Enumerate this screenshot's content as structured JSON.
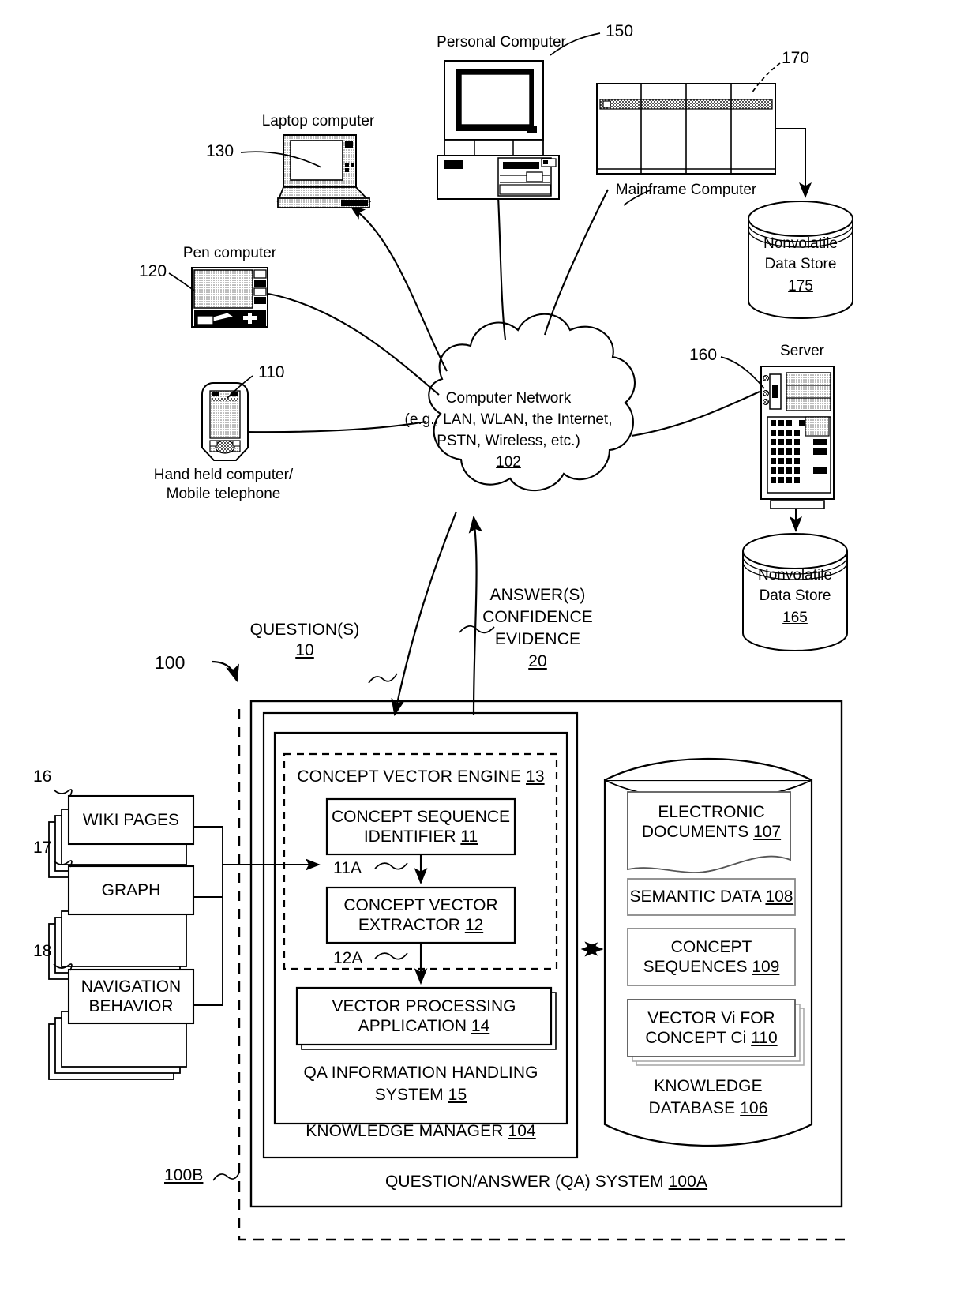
{
  "figure": {
    "main_ref": "100",
    "network": {
      "name": "Computer Network",
      "detail": "(e.g., LAN, WLAN, the Internet,",
      "detail2": "PSTN, Wireless, etc.)",
      "ref": "102"
    },
    "devices": [
      {
        "id": "handheld",
        "label_line1": "Hand held computer/",
        "label_line2": "Mobile telephone",
        "ref": "110",
        "icon": "pda-phone-icon"
      },
      {
        "id": "pen",
        "label": "Pen computer",
        "ref": "120",
        "icon": "tablet-pen-icon"
      },
      {
        "id": "laptop",
        "label": "Laptop computer",
        "ref": "130",
        "icon": "laptop-icon"
      },
      {
        "id": "pc",
        "label": "Personal Computer",
        "ref": "150",
        "icon": "desktop-computer-icon"
      },
      {
        "id": "mainframe",
        "label": "Mainframe Computer",
        "ref": "170",
        "icon": "mainframe-icon"
      },
      {
        "id": "server",
        "label": "Server",
        "ref": "160",
        "icon": "server-tower-icon"
      }
    ],
    "data_stores": [
      {
        "id": "store175",
        "line1": "Nonvolatile",
        "line2": "Data Store",
        "ref": "175"
      },
      {
        "id": "store165",
        "line1": "Nonvolatile",
        "line2": "Data Store",
        "ref": "165"
      }
    ],
    "flows": [
      {
        "id": "questions",
        "line1": "QUESTION(S)",
        "ref": "10"
      },
      {
        "id": "answers",
        "line1": "ANSWER(S)",
        "line2": "CONFIDENCE",
        "line3": "EVIDENCE",
        "ref": "20"
      }
    ],
    "sources": [
      {
        "label": "WIKI PAGES",
        "ref": "16"
      },
      {
        "label": "GRAPH",
        "ref": "17"
      },
      {
        "label_line1": "NAVIGATION",
        "label_line2": "BEHAVIOR",
        "ref": "18"
      }
    ],
    "qa_system": {
      "label": "QUESTION/ANSWER (QA) SYSTEM",
      "ref": "100A",
      "outer_ref": "100B",
      "knowledge_manager": {
        "label": "KNOWLEDGE MANAGER",
        "ref": "104"
      },
      "qa_ihs": {
        "line1": "QA INFORMATION HANDLING",
        "line2": "SYSTEM",
        "ref": "15"
      },
      "concept_vector_engine": {
        "label": "CONCEPT VECTOR ENGINE",
        "ref": "13"
      },
      "modules": [
        {
          "line1": "CONCEPT SEQUENCE",
          "line2": "IDENTIFIER",
          "ref": "11"
        },
        {
          "line1": "CONCEPT VECTOR",
          "line2": "EXTRACTOR",
          "ref": "12"
        },
        {
          "line1": "VECTOR PROCESSING",
          "line2": "APPLICATION",
          "ref": "14"
        }
      ],
      "internal_links": [
        {
          "ref": "11A"
        },
        {
          "ref": "12A"
        }
      ],
      "knowledge_database": {
        "line1": "KNOWLEDGE",
        "line2": "DATABASE",
        "ref": "106",
        "items": [
          {
            "line1": "ELECTRONIC",
            "line2": "DOCUMENTS",
            "ref": "107"
          },
          {
            "line1": "SEMANTIC DATA",
            "line2": "",
            "ref": "108"
          },
          {
            "line1": "CONCEPT",
            "line2": "SEQUENCES",
            "ref": "109"
          },
          {
            "line1": "VECTOR Vi FOR",
            "line2": "CONCEPT Ci",
            "ref": "110"
          }
        ]
      }
    }
  }
}
